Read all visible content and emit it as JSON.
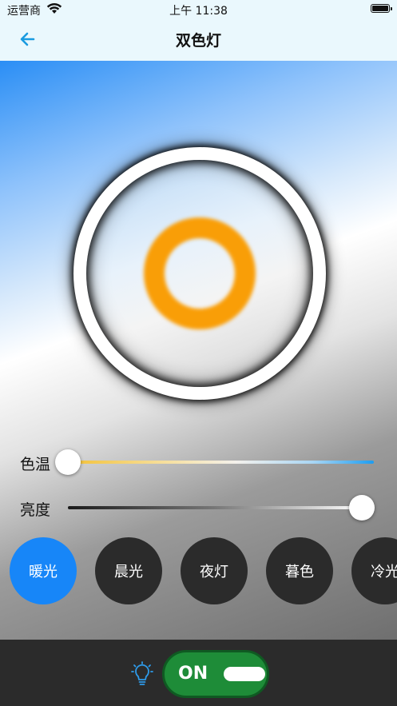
{
  "status_bar": {
    "carrier": "运营商",
    "time": "上午 11:38",
    "wifi_icon": "wifi-icon",
    "battery_icon": "battery-icon"
  },
  "nav": {
    "back_icon": "arrow-left-icon",
    "title": "双色灯"
  },
  "light_preview": {
    "glow_color": "#f99e07"
  },
  "sliders": {
    "color_temperature": {
      "label": "色温",
      "value": 0.0
    },
    "brightness": {
      "label": "亮度",
      "value": 1.0
    }
  },
  "presets": [
    {
      "label": "暖光",
      "active": true
    },
    {
      "label": "晨光",
      "active": false
    },
    {
      "label": "夜灯",
      "active": false
    },
    {
      "label": "暮色",
      "active": false
    },
    {
      "label": "冷光",
      "active": false
    }
  ],
  "bottom_bar": {
    "bulb_icon": "lightbulb-icon",
    "power_label": "ON",
    "power_on": true
  },
  "colors": {
    "accent": "#1786f8",
    "toggle_on": "#1e8c38",
    "bottom_bar": "#2b2b2b"
  }
}
